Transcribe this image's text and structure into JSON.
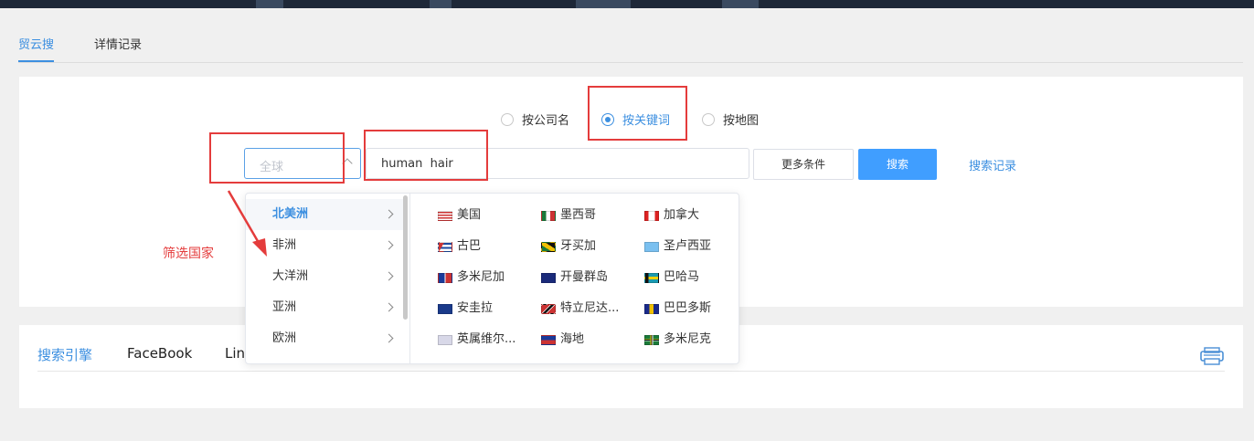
{
  "tabs": [
    {
      "label": "贸云搜",
      "active": true
    },
    {
      "label": "详情记录",
      "active": false
    }
  ],
  "search_mode": {
    "options": [
      {
        "label": "按公司名",
        "checked": false
      },
      {
        "label": "按关键词",
        "checked": true
      },
      {
        "label": "按地图",
        "checked": false
      }
    ]
  },
  "search": {
    "region_placeholder": "全球",
    "keyword_value": "human  hair",
    "more_label": "更多条件",
    "search_label": "搜索",
    "history_label": "搜索记录"
  },
  "dropdown": {
    "continents": [
      {
        "label": "北美洲",
        "active": true
      },
      {
        "label": "非洲",
        "active": false
      },
      {
        "label": "大洋洲",
        "active": false
      },
      {
        "label": "亚洲",
        "active": false
      },
      {
        "label": "欧洲",
        "active": false
      }
    ],
    "countries": [
      {
        "label": "美国",
        "flag": "us-flag-icon"
      },
      {
        "label": "墨西哥",
        "flag": "mexico-flag-icon"
      },
      {
        "label": "加拿大",
        "flag": "canada-flag-icon"
      },
      {
        "label": "古巴",
        "flag": "cuba-flag-icon"
      },
      {
        "label": "牙买加",
        "flag": "jamaica-flag-icon"
      },
      {
        "label": "圣卢西亚",
        "flag": "saint-lucia-flag-icon"
      },
      {
        "label": "多米尼加",
        "flag": "dominican-republic-flag-icon"
      },
      {
        "label": "开曼群岛",
        "flag": "cayman-islands-flag-icon"
      },
      {
        "label": "巴哈马",
        "flag": "bahamas-flag-icon"
      },
      {
        "label": "安圭拉",
        "flag": "anguilla-flag-icon"
      },
      {
        "label": "特立尼达...",
        "flag": "trinidad-flag-icon"
      },
      {
        "label": "巴巴多斯",
        "flag": "barbados-flag-icon"
      },
      {
        "label": "英属维尔...",
        "flag": "bvi-flag-icon"
      },
      {
        "label": "海地",
        "flag": "haiti-flag-icon"
      },
      {
        "label": "多米尼克",
        "flag": "dominica-flag-icon"
      }
    ]
  },
  "annotation": {
    "label": "筛选国家",
    "color": "#e43c3c"
  },
  "engine_tabs": [
    {
      "label": "搜索引擎",
      "active": true
    },
    {
      "label": "FaceBook",
      "active": false
    },
    {
      "label": "Lin",
      "active": false
    }
  ],
  "colors": {
    "accent": "#3c8fe0",
    "primary_button": "#409eff",
    "annotation": "#e43c3c"
  }
}
